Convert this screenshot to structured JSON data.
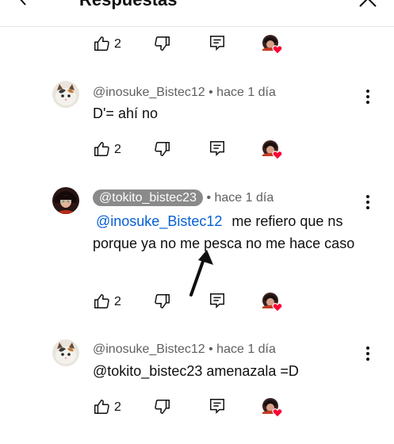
{
  "header": {
    "title": "Respuestas"
  },
  "first_actions": {
    "likes": "2"
  },
  "comments": [
    {
      "author": "@inosuke_Bistec12",
      "time": "hace 1 día",
      "text": "D'= ahí no",
      "likes": "2",
      "avatar": "calico-cat-avatar"
    },
    {
      "author": "@tokito_bistec23",
      "time": "hace 1 día",
      "mention": "@inosuke_Bistec12",
      "text": "me refiero que ns porque ya no me pesca no me hace caso",
      "likes": "2",
      "avatar": "anime-character-avatar",
      "highlighted": true
    },
    {
      "author": "@inosuke_Bistec12",
      "time": "hace 1 día",
      "text": "@tokito_bistec23 amenazala =D",
      "likes": "2",
      "avatar": "calico-cat-avatar"
    }
  ],
  "separator": "•",
  "colors": {
    "heart": "#ff0033",
    "mention": "#065fd4",
    "handle_chip": "#8a8a8a",
    "meta": "#606060"
  },
  "icons": [
    "back-arrow-icon",
    "close-icon",
    "thumbs-up-icon",
    "thumbs-down-icon",
    "reply-icon",
    "creator-heart-icon",
    "more-vert-icon"
  ]
}
